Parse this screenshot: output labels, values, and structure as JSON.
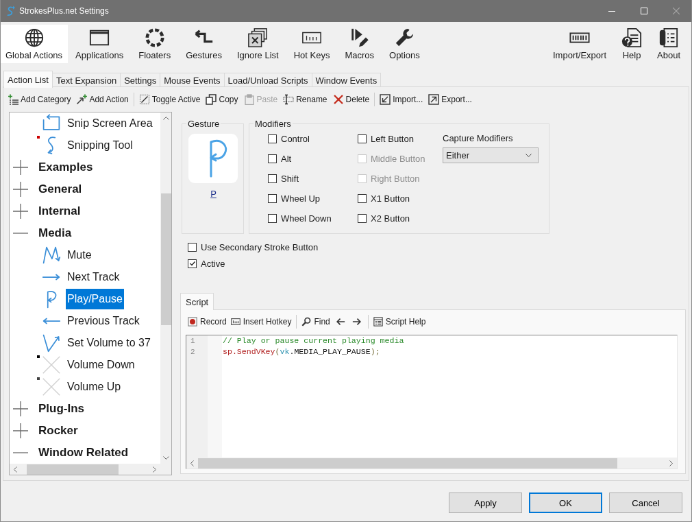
{
  "window": {
    "title": "StrokesPlus.net Settings"
  },
  "toolbar": {
    "left": [
      {
        "label": "Global Actions",
        "selected": true
      },
      {
        "label": "Applications",
        "selected": false
      },
      {
        "label": "Floaters",
        "selected": false
      },
      {
        "label": "Gestures",
        "selected": false
      },
      {
        "label": "Ignore List",
        "selected": false
      },
      {
        "label": "Hot Keys",
        "selected": false
      },
      {
        "label": "Macros",
        "selected": false
      },
      {
        "label": "Options",
        "selected": false
      }
    ],
    "right": [
      {
        "label": "Import/Export",
        "selected": false
      },
      {
        "label": "Help",
        "selected": false
      },
      {
        "label": "About",
        "selected": false
      }
    ]
  },
  "tabs": [
    {
      "label": "Action List",
      "selected": true
    },
    {
      "label": "Text Expansion",
      "selected": false
    },
    {
      "label": "Settings",
      "selected": false
    },
    {
      "label": "Mouse Events",
      "selected": false
    },
    {
      "label": "Load/Unload Scripts",
      "selected": false
    },
    {
      "label": "Window Events",
      "selected": false
    }
  ],
  "action_toolbar": {
    "groups": [
      {
        "items": [
          {
            "label": "Add Category",
            "disabled": false
          },
          {
            "label": "Add Action",
            "disabled": false
          }
        ]
      },
      {
        "items": [
          {
            "label": "Toggle Active",
            "disabled": false
          },
          {
            "label": "Copy",
            "disabled": false
          },
          {
            "label": "Paste",
            "disabled": true
          },
          {
            "label": "Rename",
            "disabled": false
          },
          {
            "label": "Delete",
            "disabled": false
          }
        ]
      },
      {
        "items": [
          {
            "label": "Import...",
            "disabled": false
          },
          {
            "label": "Export...",
            "disabled": false
          }
        ]
      }
    ]
  },
  "tree": {
    "items": [
      {
        "children": [
          {
            "label": "Snip Screen Area",
            "selected": false
          },
          {
            "label": "Snipping Tool",
            "selected": false,
            "color": "#cc0000"
          }
        ]
      },
      {
        "label": "Examples",
        "expanded": false,
        "selected": false
      },
      {
        "label": "General",
        "expanded": false,
        "selected": false
      },
      {
        "label": "Internal",
        "expanded": false,
        "selected": false
      },
      {
        "label": "Media",
        "expanded": true,
        "selected": false,
        "children": [
          {
            "label": "Mute",
            "selected": false
          },
          {
            "label": "Next Track",
            "selected": false
          },
          {
            "label": "Play/Pause",
            "selected": true
          },
          {
            "label": "Previous Track",
            "selected": false
          },
          {
            "label": "Set Volume to 37",
            "selected": false
          },
          {
            "label": "Volume Down",
            "selected": false,
            "color": "#000000"
          },
          {
            "label": "Volume Up",
            "selected": false,
            "color": "#404040"
          }
        ]
      },
      {
        "label": "Plug-Ins",
        "expanded": false,
        "selected": false
      },
      {
        "label": "Rocker",
        "expanded": false,
        "selected": false
      },
      {
        "label": "Window Related",
        "expanded": true,
        "selected": false
      }
    ]
  },
  "gesture": {
    "title": "Gesture",
    "link": "P"
  },
  "modifiers": {
    "title": "Modifiers",
    "columns": [
      {
        "items": [
          {
            "label": "Control",
            "checked": false,
            "disabled": false
          },
          {
            "label": "Alt",
            "checked": false,
            "disabled": false
          },
          {
            "label": "Shift",
            "checked": false,
            "disabled": false
          },
          {
            "label": "Wheel Up",
            "checked": false,
            "disabled": false
          },
          {
            "label": "Wheel Down",
            "checked": false,
            "disabled": false
          }
        ]
      },
      {
        "items": [
          {
            "label": "Left Button",
            "checked": false,
            "disabled": false
          },
          {
            "label": "Middle Button",
            "checked": false,
            "disabled": true
          },
          {
            "label": "Right Button",
            "checked": false,
            "disabled": true
          },
          {
            "label": "X1 Button",
            "checked": false,
            "disabled": false
          },
          {
            "label": "X2 Button",
            "checked": false,
            "disabled": false
          }
        ]
      }
    ],
    "capture": {
      "label": "Capture Modifiers",
      "value": "Either"
    }
  },
  "options": [
    {
      "label": "Use Secondary Stroke Button",
      "checked": false
    },
    {
      "label": "Active",
      "checked": true
    }
  ],
  "script": {
    "tab": {
      "label": "Script",
      "selected": true
    },
    "toolbar": {
      "groups": [
        {
          "items": [
            {
              "kind": "button",
              "label": "Record"
            },
            {
              "kind": "button",
              "label": "Insert Hotkey"
            }
          ]
        },
        {
          "items": [
            {
              "kind": "button",
              "label": "Find"
            },
            {
              "kind": "icon_button"
            },
            {
              "kind": "icon_button"
            }
          ]
        },
        {
          "items": [
            {
              "kind": "button",
              "label": "Script Help"
            }
          ]
        }
      ]
    },
    "lines": [
      {
        "number": "1",
        "tokens": [
          {
            "kind": "comment",
            "text": "// Play or pause current playing media"
          }
        ]
      },
      {
        "number": "2",
        "tokens": [
          {
            "kind": "method",
            "text": "sp.SendVKey"
          },
          {
            "kind": "punctuation",
            "text": "("
          },
          {
            "kind": "object",
            "text": "vk"
          },
          {
            "kind": "plain",
            "text": ".MEDIA_PLAY_PAUSE"
          },
          {
            "kind": "punctuation",
            "text": ");"
          }
        ]
      }
    ]
  },
  "buttons": [
    {
      "label": "Apply",
      "default": false
    },
    {
      "label": "OK",
      "default": true
    },
    {
      "label": "Cancel",
      "default": false
    }
  ]
}
